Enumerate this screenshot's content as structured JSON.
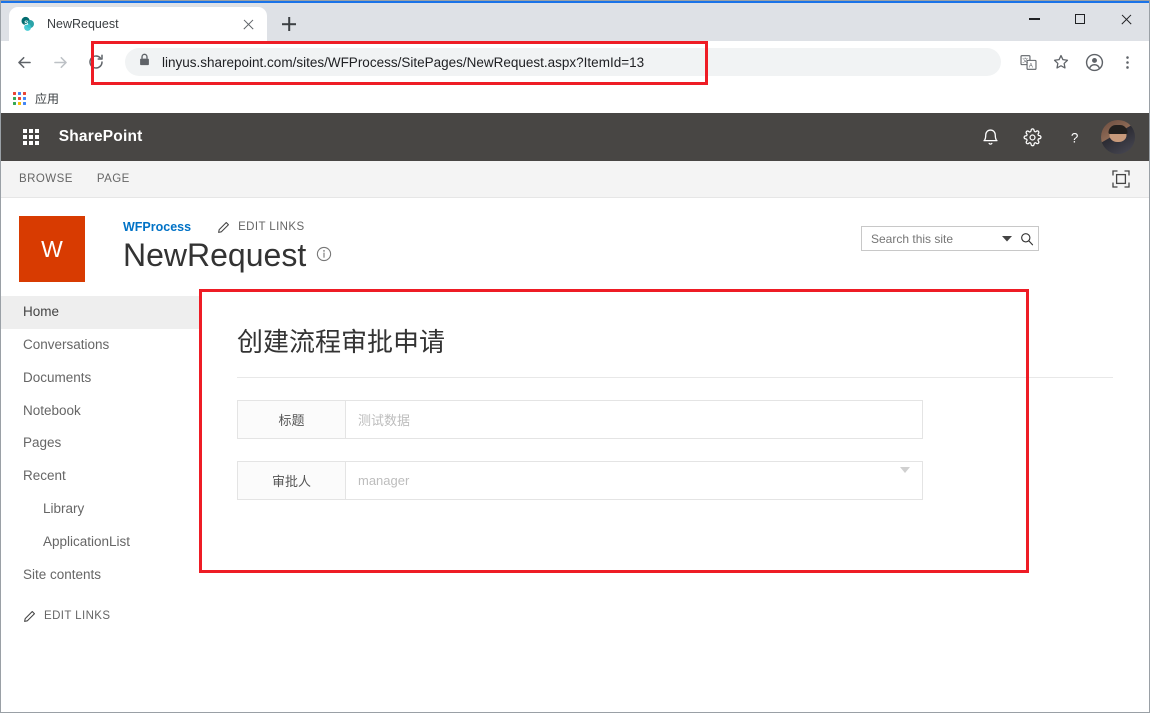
{
  "browser": {
    "tab": {
      "title": "NewRequest",
      "favicon": "sharepoint-favicon"
    },
    "newtab_label": "+",
    "window_controls": {
      "minimize": "minimize",
      "maximize": "maximize",
      "close": "close"
    },
    "nav": {
      "back": "back-arrow",
      "forward": "forward-arrow",
      "reload": "reload-arrow"
    },
    "omnibox": {
      "lock_icon": "lock-icon",
      "url_bold": "linyus.sharepoint.com",
      "url_rest": "/sites/WFProcess/SitePages/NewRequest.aspx?ItemId=13",
      "url_full": "linyus.sharepoint.com/sites/WFProcess/SitePages/NewRequest.aspx?ItemId=13"
    },
    "toolbar_icons": [
      "translate-icon",
      "bookmark-star-icon",
      "profile-icon",
      "more-menu-icon"
    ],
    "bookmarks": {
      "apps_label": "应用",
      "apps_icon": "apps-grid-icon"
    }
  },
  "suitebar": {
    "waffle_icon": "app-launcher-icon",
    "brand": "SharePoint",
    "icons": [
      "notifications-bell-icon",
      "settings-gear-icon",
      "help-question-icon"
    ],
    "avatar": "user-avatar",
    "background": "#484644"
  },
  "ribbon": {
    "tabs": [
      {
        "label": "BROWSE"
      },
      {
        "label": "PAGE"
      }
    ],
    "focus_icon": "focus-on-content-icon"
  },
  "site": {
    "logo_letter": "W",
    "logo_color": "#d83b01",
    "name": "WFProcess",
    "edit_links_label": "EDIT LINKS",
    "pencil_icon": "pencil-icon",
    "page_title": "NewRequest",
    "info_icon": "info-icon"
  },
  "search": {
    "placeholder": "Search this site",
    "chevron_icon": "chevron-down-icon",
    "search_icon": "search-magnifier-icon"
  },
  "leftnav": {
    "items": [
      {
        "label": "Home",
        "selected": true,
        "sub": false
      },
      {
        "label": "Conversations",
        "selected": false,
        "sub": false
      },
      {
        "label": "Documents",
        "selected": false,
        "sub": false
      },
      {
        "label": "Notebook",
        "selected": false,
        "sub": false
      },
      {
        "label": "Pages",
        "selected": false,
        "sub": false
      },
      {
        "label": "Recent",
        "selected": false,
        "sub": false
      },
      {
        "label": "Library",
        "selected": false,
        "sub": true
      },
      {
        "label": "ApplicationList",
        "selected": false,
        "sub": true
      },
      {
        "label": "Site contents",
        "selected": false,
        "sub": false
      }
    ],
    "edit_links_label": "EDIT LINKS",
    "pencil_icon": "pencil-icon"
  },
  "form": {
    "title": "创建流程审批申请",
    "fields": [
      {
        "label": "标题",
        "value": "测试数据",
        "type": "text"
      },
      {
        "label": "审批人",
        "value": "manager",
        "type": "dropdown"
      }
    ]
  },
  "annotations": {
    "color": "#ee1c25",
    "regions": [
      "address-bar-highlight",
      "form-area-highlight"
    ]
  }
}
